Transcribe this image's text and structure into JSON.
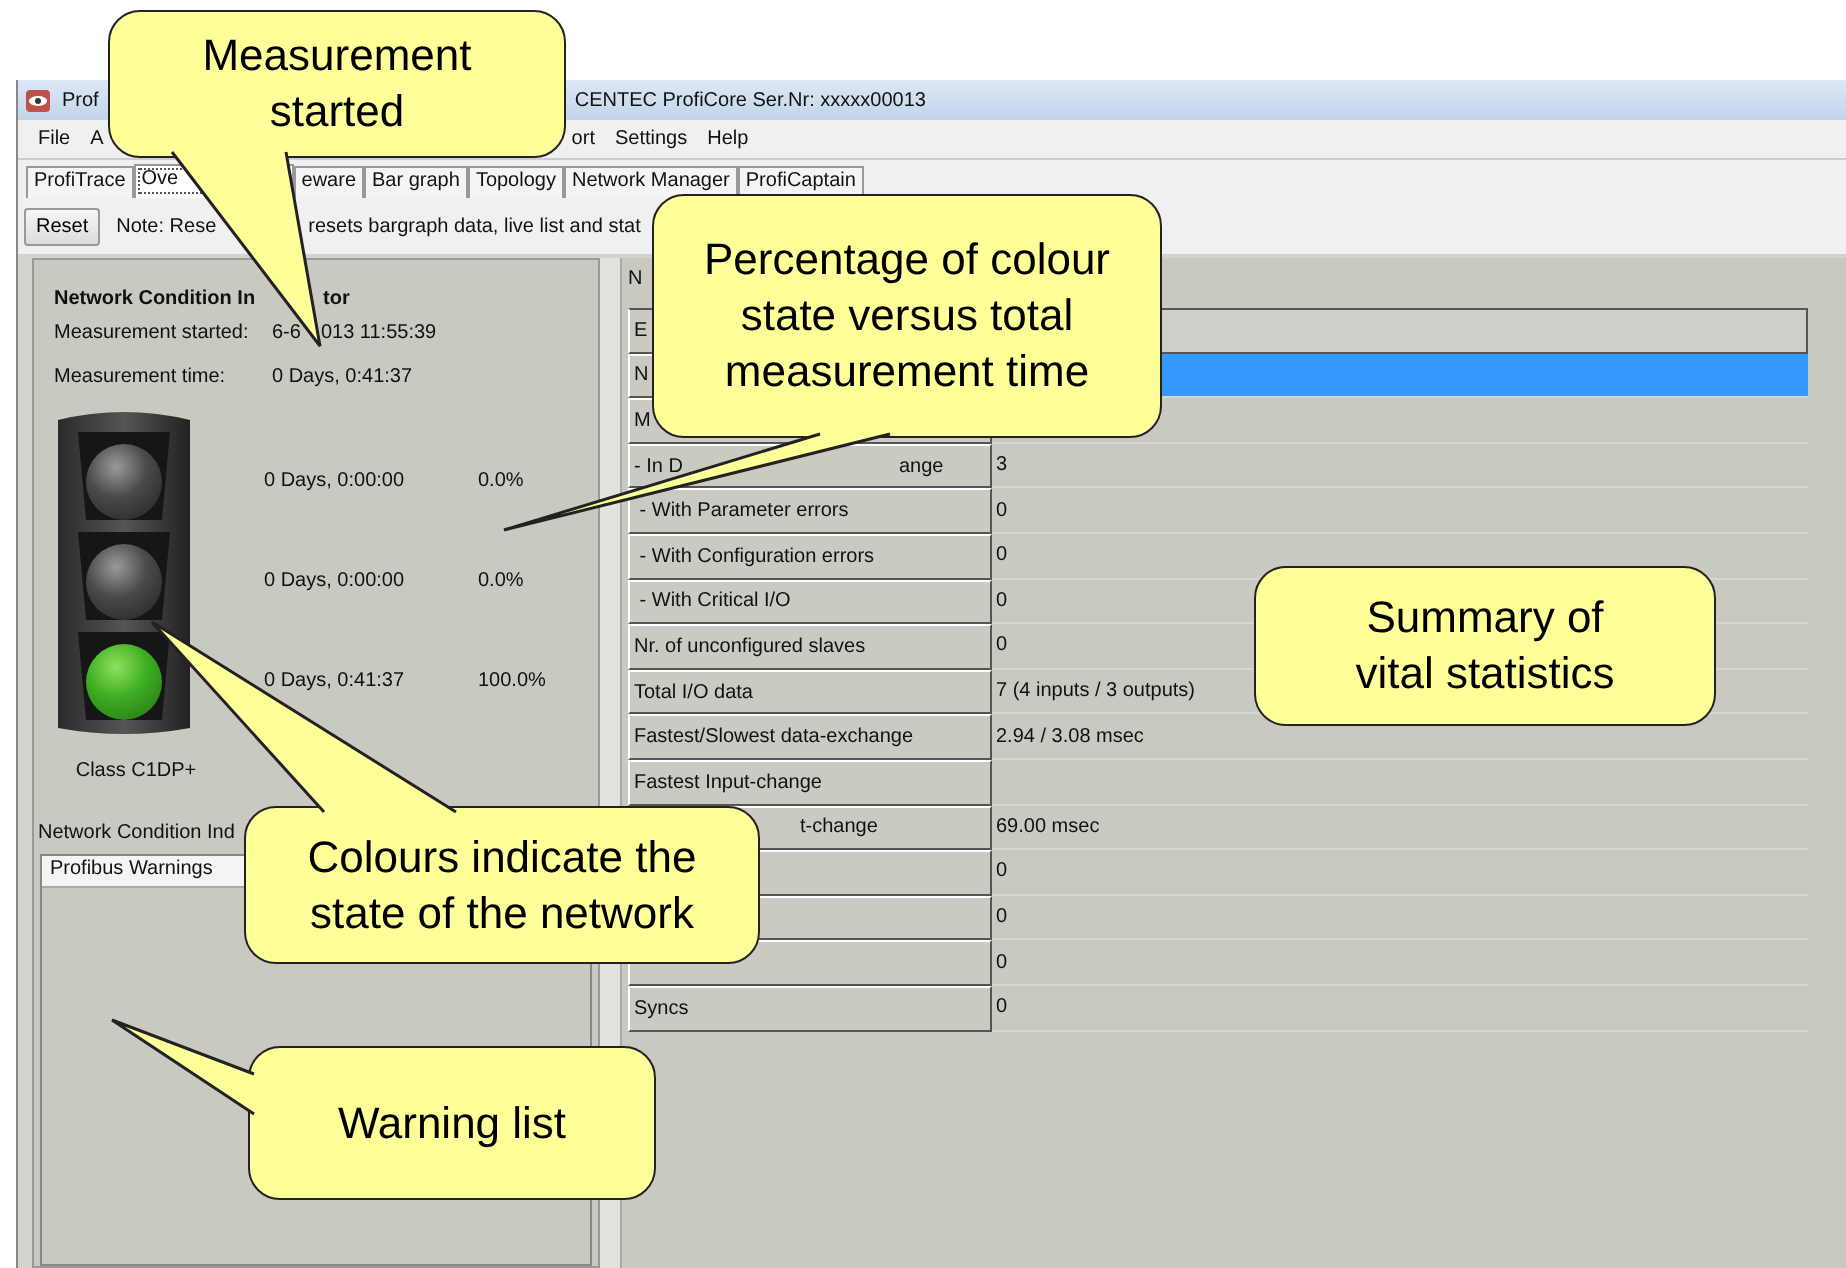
{
  "window": {
    "title_parts": [
      "Prof",
      "CENTEC  ProfiCore Ser.Nr: xxxxx00013"
    ]
  },
  "menu": [
    "File",
    "A",
    "ort",
    "Settings",
    "Help"
  ],
  "tabs": [
    {
      "label": "ProfiTrace",
      "selected": false
    },
    {
      "label": "Ove",
      "selected": true
    },
    {
      "label": "eware",
      "selected": false
    },
    {
      "label": "Bar graph",
      "selected": false
    },
    {
      "label": "Topology",
      "selected": false
    },
    {
      "label": "Network Manager",
      "selected": false
    },
    {
      "label": "ProfiCaptain",
      "selected": false
    }
  ],
  "toolbar": {
    "reset": "Reset",
    "note_parts": [
      "Note: Rese",
      "resets bargraph data, live list and stat"
    ]
  },
  "indicator": {
    "title_parts": [
      "Network Condition In",
      "tor"
    ],
    "started_label": "Measurement started:",
    "started_parts": [
      "6-6",
      "013 11:55:39"
    ],
    "time_label": "Measurement time:",
    "time": "0 Days, 0:41:37",
    "lamps": [
      {
        "on": false,
        "duration": "0 Days, 0:00:00",
        "percent": "0.0%"
      },
      {
        "on": false,
        "duration": "0 Days, 0:00:00",
        "percent": "0.0%"
      },
      {
        "on": true,
        "duration": "0 Days, 0:41:37",
        "percent": "100.0%"
      }
    ],
    "class_label": "Class C1DP+"
  },
  "warnings": {
    "caption": "Network Condition Ind",
    "header": "Profibus Warnings"
  },
  "stats": {
    "heading": "N",
    "rows": [
      {
        "kind": "header",
        "label": "E",
        "value": "",
        "selected": false
      },
      {
        "kind": "plain",
        "label": "N",
        "value": "",
        "selected": true
      },
      {
        "kind": "plain",
        "label": "M",
        "value": "",
        "selected": false
      },
      {
        "kind": "split",
        "parts": [
          "- In D",
          "ange"
        ],
        "value": "3",
        "selected": false
      },
      {
        "kind": "plain",
        "label": " - With Parameter errors",
        "value": "0",
        "selected": false
      },
      {
        "kind": "plain",
        "label": " - With Configuration errors",
        "value": "0",
        "selected": false
      },
      {
        "kind": "plain",
        "label": " - With Critical I/O",
        "value": "0",
        "selected": false
      },
      {
        "kind": "plain",
        "label": "Nr. of unconfigured slaves",
        "value": "0",
        "selected": false
      },
      {
        "kind": "plain",
        "label": "Total I/O data",
        "value": "7 (4 inputs / 3 outputs)",
        "selected": false
      },
      {
        "kind": "plain",
        "label": "Fastest/Slowest data-exchange",
        "value": "2.94 / 3.08 msec",
        "selected": false
      },
      {
        "kind": "plain",
        "label": "Fastest Input-change",
        "value": "",
        "selected": false
      },
      {
        "kind": "obscured",
        "label": "t-change",
        "value": "69.00 msec",
        "selected": false
      },
      {
        "kind": "plain",
        "label": "",
        "value": "0",
        "selected": false
      },
      {
        "kind": "plain",
        "label": "",
        "value": "0",
        "selected": false
      },
      {
        "kind": "plain",
        "label": "",
        "value": "0",
        "selected": false
      },
      {
        "kind": "plain",
        "label": "Syncs",
        "value": "0",
        "selected": false
      }
    ]
  },
  "callouts": [
    {
      "text": "Measurement\nstarted"
    },
    {
      "text": "Percentage of colour\nstate versus total\nmeasurement time"
    },
    {
      "text": "Summary of\nvital statistics"
    },
    {
      "text": "Colours indicate the\nstate of the network"
    },
    {
      "text": "Warning list"
    }
  ]
}
